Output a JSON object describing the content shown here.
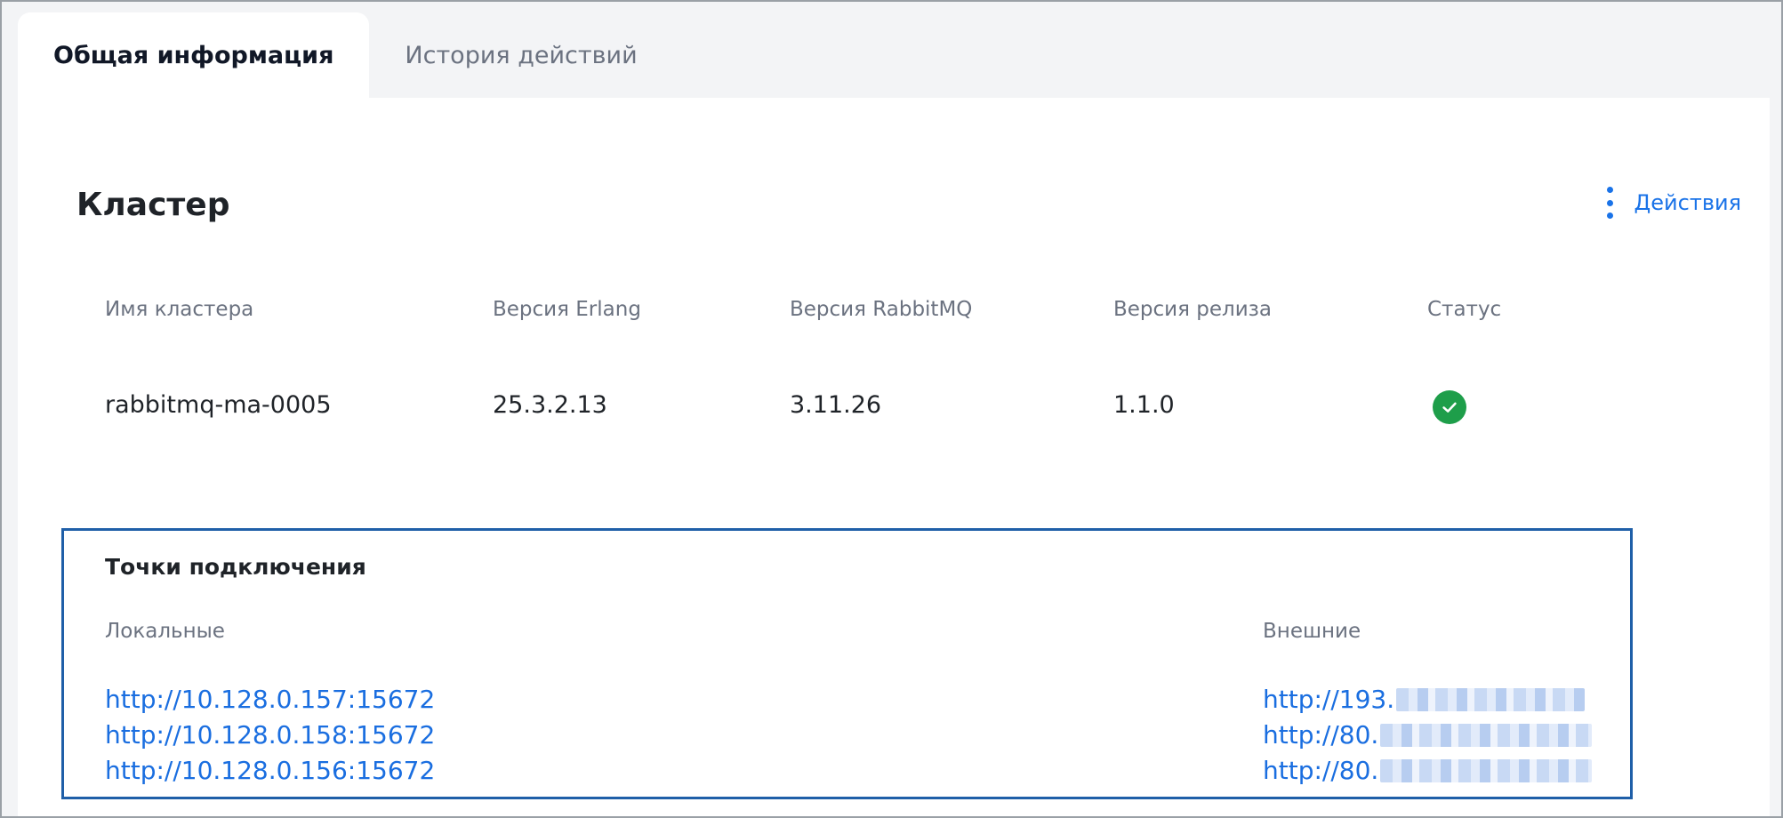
{
  "tabs": [
    {
      "label": "Общая информация",
      "active": true
    },
    {
      "label": "История действий",
      "active": false
    }
  ],
  "cluster": {
    "title": "Кластер",
    "actions_label": "Действия",
    "columns": [
      {
        "label": "Имя кластера",
        "value": "rabbitmq-ma-0005"
      },
      {
        "label": "Версия Erlang",
        "value": "25.3.2.13"
      },
      {
        "label": "Версия RabbitMQ",
        "value": "3.11.26"
      },
      {
        "label": "Версия релиза",
        "value": "1.1.0"
      },
      {
        "label": "Статус",
        "status": "ok"
      }
    ]
  },
  "endpoints": {
    "title": "Точки подключения",
    "local_label": "Локальные",
    "external_label": "Внешние",
    "local": [
      "http://10.128.0.157:15672",
      "http://10.128.0.158:15672",
      "http://10.128.0.156:15672"
    ],
    "external": [
      "http://193.",
      "http://80.",
      "http://80."
    ]
  },
  "colors": {
    "accent": "#1a73e8",
    "link": "#1a6ee0",
    "status_ok": "#1e9e4a",
    "highlight_border": "#1f5fa8",
    "background": "#f3f4f6"
  },
  "icons": {
    "actions": "kebab-vertical-icon",
    "status": "check-circle-icon"
  }
}
